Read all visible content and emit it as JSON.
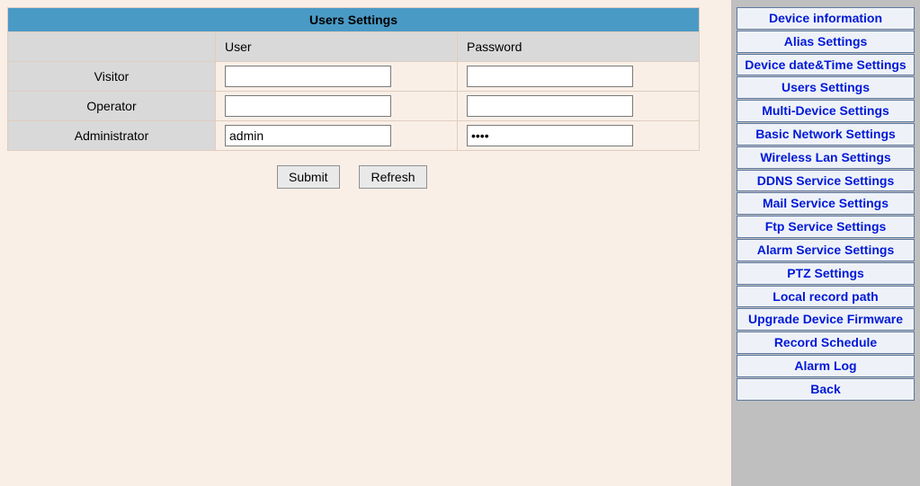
{
  "page": {
    "title": "Users Settings",
    "columns": {
      "user": "User",
      "password": "Password"
    },
    "rows": [
      {
        "role": "Visitor",
        "user": "",
        "password": ""
      },
      {
        "role": "Operator",
        "user": "",
        "password": ""
      },
      {
        "role": "Administrator",
        "user": "admin",
        "password": "••••"
      }
    ],
    "buttons": {
      "submit": "Submit",
      "refresh": "Refresh"
    }
  },
  "sidebar": {
    "items": [
      "Device information",
      "Alias Settings",
      "Device date&Time Settings",
      "Users Settings",
      "Multi-Device Settings",
      "Basic Network Settings",
      "Wireless Lan Settings",
      "DDNS Service Settings",
      "Mail Service Settings",
      "Ftp Service Settings",
      "Alarm Service Settings",
      "PTZ Settings",
      "Local record path",
      "Upgrade Device Firmware",
      "Record Schedule",
      "Alarm Log",
      "Back"
    ]
  }
}
